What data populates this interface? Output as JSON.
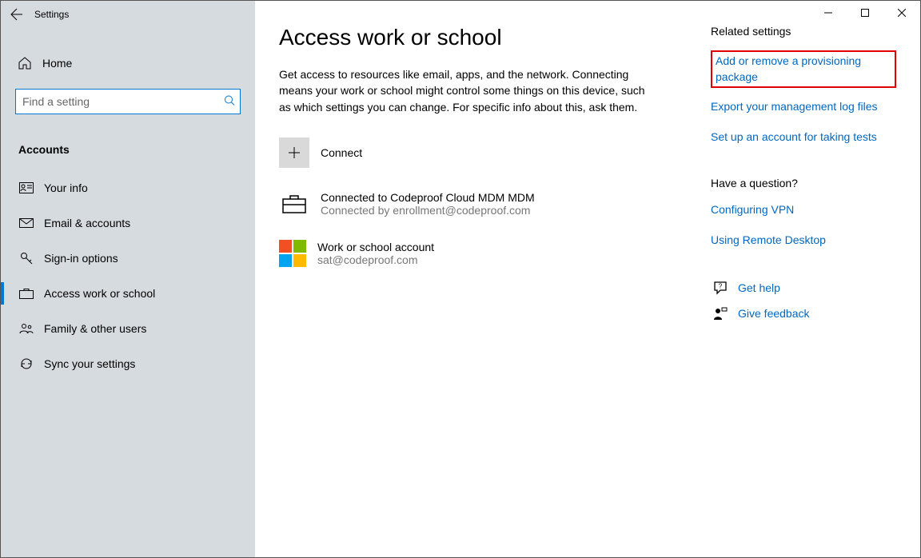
{
  "header": {
    "title": "Settings"
  },
  "sidebar": {
    "home_label": "Home",
    "search_placeholder": "Find a setting",
    "section_title": "Accounts",
    "items": [
      {
        "label": "Your info"
      },
      {
        "label": "Email & accounts"
      },
      {
        "label": "Sign-in options"
      },
      {
        "label": "Access work or school"
      },
      {
        "label": "Family & other users"
      },
      {
        "label": "Sync your settings"
      }
    ]
  },
  "page": {
    "title": "Access work or school",
    "description": "Get access to resources like email, apps, and the network. Connecting means your work or school might control some things on this device, such as which settings you can change. For specific info about this, ask them.",
    "connect_label": "Connect",
    "mdm_title": "Connected to Codeproof Cloud MDM MDM",
    "mdm_sub": "Connected by enrollment@codeproof.com",
    "work_title": "Work or school account",
    "work_sub": "sat@codeproof.com"
  },
  "related": {
    "heading": "Related settings",
    "link_provisioning": "Add or remove a provisioning package",
    "link_export": "Export your management log files",
    "link_testaccount": "Set up an account for taking tests"
  },
  "question": {
    "heading": "Have a question?",
    "link_vpn": "Configuring VPN",
    "link_remote": "Using Remote Desktop"
  },
  "support": {
    "get_help": "Get help",
    "feedback": "Give feedback"
  }
}
